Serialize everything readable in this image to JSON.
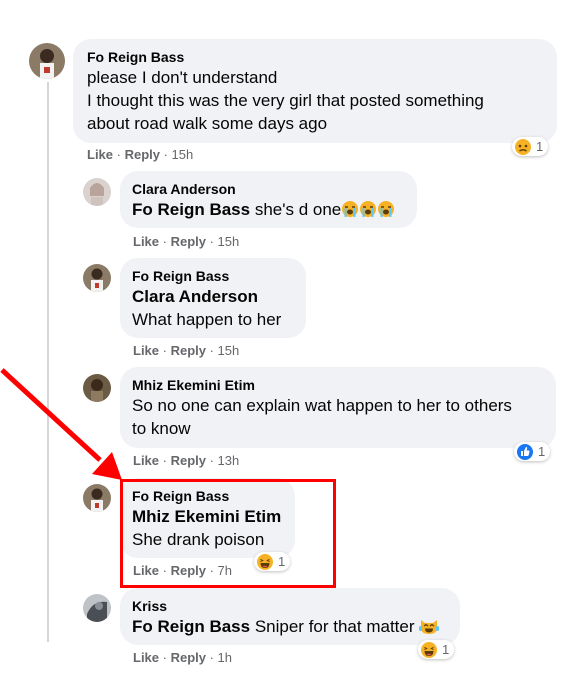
{
  "comments": [
    {
      "author": "Fo Reign Bass",
      "lines": [
        "please I don't understand",
        "I thought this was the very girl that posted something",
        "about road walk some days ago"
      ],
      "like": "Like",
      "reply": "Reply",
      "time": "15h",
      "reaction": {
        "icon": "sad-reaction-icon",
        "count": "1"
      }
    },
    {
      "author": "Clara Anderson",
      "tag": "Fo Reign Bass",
      "text": "she's d one",
      "emojis": [
        "loudly-crying-face",
        "loudly-crying-face",
        "loudly-crying-face"
      ],
      "like": "Like",
      "reply": "Reply",
      "time": "15h"
    },
    {
      "author": "Fo Reign Bass",
      "tag": "Clara Anderson",
      "text": "What happen to her",
      "like": "Like",
      "reply": "Reply",
      "time": "15h"
    },
    {
      "author": "Mhiz Ekemini Etim",
      "lines": [
        "So no one can explain wat happen to her to others",
        "to know"
      ],
      "like": "Like",
      "reply": "Reply",
      "time": "13h",
      "reaction": {
        "icon": "like-reaction-icon",
        "count": "1"
      }
    },
    {
      "author": "Fo Reign Bass",
      "tag": "Mhiz Ekemini Etim",
      "text": "She drank poison",
      "like": "Like",
      "reply": "Reply",
      "time": "7h",
      "reaction": {
        "icon": "haha-reaction-icon",
        "count": "1"
      }
    },
    {
      "author": "Kriss",
      "tag": "Fo Reign Bass",
      "text": "Sniper for that matter",
      "emojis": [
        "cat-tears-of-joy"
      ],
      "like": "Like",
      "reply": "Reply",
      "time": "1h",
      "reaction": {
        "icon": "haha-reaction-icon",
        "count": "1"
      }
    }
  ],
  "annotation": {
    "arrow_color": "#ff0000",
    "box_color": "#ff0000"
  },
  "colors": {
    "bubble": "#f0f2f5",
    "meta": "#65676b",
    "like_blue": "#1877f2",
    "reaction_yellow": "#f7b125"
  }
}
